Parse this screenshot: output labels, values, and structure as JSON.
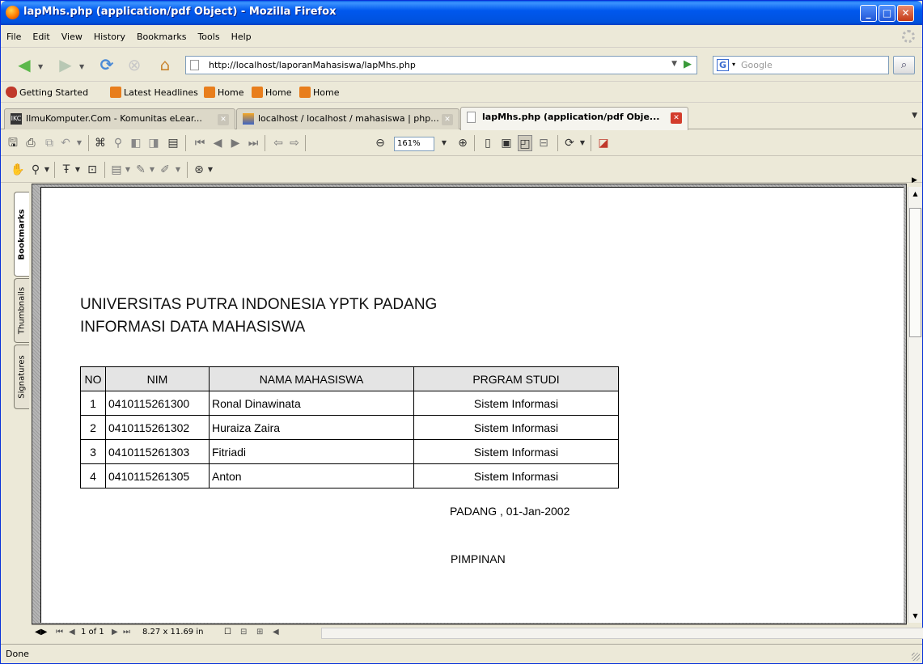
{
  "window": {
    "title": "lapMhs.php (application/pdf Object) - Mozilla Firefox"
  },
  "menu": [
    "File",
    "Edit",
    "View",
    "History",
    "Bookmarks",
    "Tools",
    "Help"
  ],
  "nav": {
    "url": "http://localhost/laporanMahasiswa/lapMhs.php",
    "search_placeholder": "Google"
  },
  "bookmarks": [
    "Getting Started",
    "Latest Headlines",
    "Home",
    "Home",
    "Home"
  ],
  "tabs": [
    {
      "label": "IlmuKomputer.Com - Komunitas eLear...",
      "favicon": "ikc-icon",
      "active": false
    },
    {
      "label": "localhost / localhost / mahasiswa | php...",
      "favicon": "pma-icon",
      "active": false
    },
    {
      "label": "lapMhs.php (application/pdf Obje...",
      "favicon": "page-icon",
      "active": true
    }
  ],
  "pdf_toolbar": {
    "zoom": "161%"
  },
  "side_tabs": [
    "Bookmarks",
    "Thumbnails",
    "Signatures"
  ],
  "document": {
    "heading_line1": "UNIVERSITAS PUTRA INDONESIA YPTK PADANG",
    "heading_line2": "INFORMASI DATA MAHASISWA",
    "table": {
      "headers": [
        "NO",
        "NIM",
        "NAMA MAHASISWA",
        "PRGRAM STUDI"
      ],
      "rows": [
        [
          "1",
          "0410115261300",
          "Ronal Dinawinata",
          "Sistem Informasi"
        ],
        [
          "2",
          "0410115261302",
          "Huraiza Zaira",
          "Sistem Informasi"
        ],
        [
          "3",
          "0410115261303",
          "Fitriadi",
          "Sistem Informasi"
        ],
        [
          "4",
          "0410115261305",
          "Anton",
          "Sistem Informasi"
        ]
      ]
    },
    "place_date": "PADANG , 01-Jan-2002",
    "signature_title": "PIMPINAN"
  },
  "pdf_status": {
    "page": "1 of 1",
    "page_size": "8.27 x 11.69 in"
  },
  "statusbar": {
    "text": "Done"
  }
}
